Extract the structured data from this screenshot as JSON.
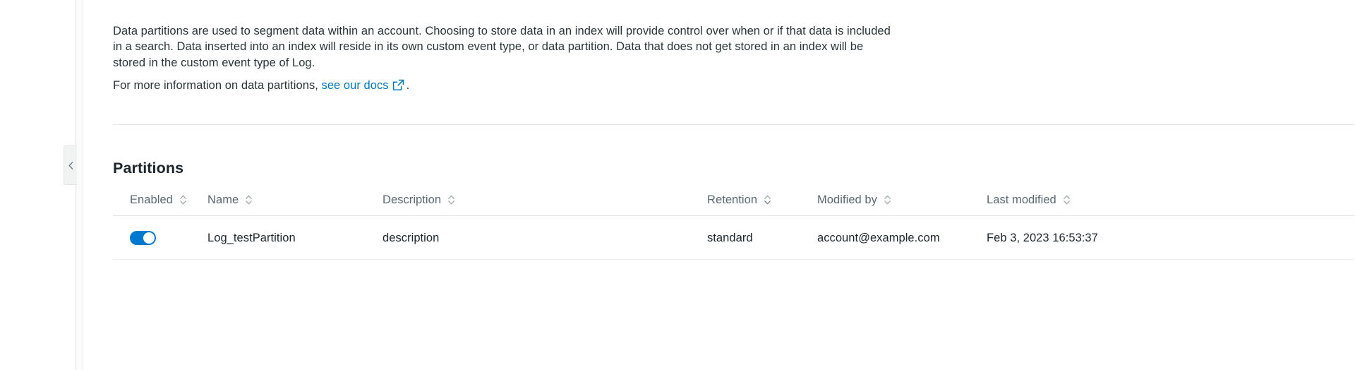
{
  "sidebar": {
    "collapse_icon": "chevron-left-icon"
  },
  "intro": {
    "paragraph": "Data partitions are used to segment data within an account. Choosing to store data in an index will provide control over when or if that data is included in a search. Data inserted into an index will reside in its own custom event type, or data partition. Data that does not get stored in an index will be stored in the custom event type of Log.",
    "link_prefix": "For more information on data partitions,",
    "link_text": "see our docs",
    "link_icon": "external-link-icon",
    "link_suffix": ".",
    "link_color": "#0079bf"
  },
  "section": {
    "title": "Partitions"
  },
  "table": {
    "sort_icon": "sort-chevrons-icon",
    "columns": [
      {
        "key": "enabled",
        "label": "Enabled"
      },
      {
        "key": "name",
        "label": "Name"
      },
      {
        "key": "description",
        "label": "Description"
      },
      {
        "key": "retention",
        "label": "Retention"
      },
      {
        "key": "modified_by",
        "label": "Modified by"
      },
      {
        "key": "last_modified",
        "label": "Last modified"
      }
    ],
    "rows": [
      {
        "enabled": true,
        "enabled_icon": "toggle-on-icon",
        "name": "Log_testPartition",
        "description": "description",
        "retention": "standard",
        "modified_by": "account@example.com",
        "last_modified": "Feb 3, 2023 16:53:37"
      }
    ],
    "toggle_on_color": "#007ace"
  }
}
